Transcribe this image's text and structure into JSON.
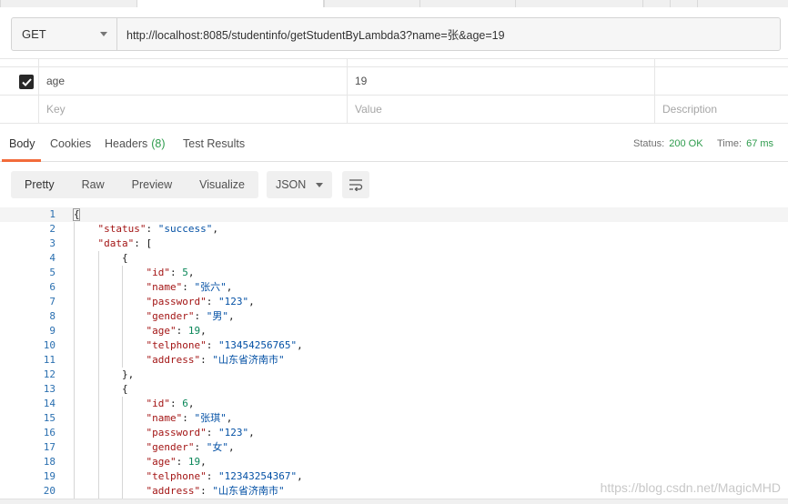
{
  "request": {
    "method": "GET",
    "url": "http://localhost:8085/studentinfo/getStudentByLambda3?name=张&age=19"
  },
  "params": {
    "rows": [
      {
        "key": "age",
        "value": "19",
        "checked": true
      }
    ],
    "placeholder": {
      "key": "Key",
      "value": "Value",
      "description": "Description"
    }
  },
  "response_tabs": {
    "body": "Body",
    "cookies": "Cookies",
    "headers": "Headers",
    "headers_count": "(8)",
    "tests": "Test Results"
  },
  "status": {
    "status_label": "Status:",
    "status_value": "200 OK",
    "time_label": "Time:",
    "time_value": "67 ms"
  },
  "view_modes": {
    "pretty": "Pretty",
    "raw": "Raw",
    "preview": "Preview",
    "visualize": "Visualize",
    "format": "JSON"
  },
  "code_lines": [
    {
      "n": "1",
      "indent": 0,
      "parts": [
        [
          "p",
          "{"
        ]
      ]
    },
    {
      "n": "2",
      "indent": 1,
      "parts": [
        [
          "k",
          "\"status\""
        ],
        [
          "p",
          ": "
        ],
        [
          "s",
          "\"success\""
        ],
        [
          "p",
          ","
        ]
      ]
    },
    {
      "n": "3",
      "indent": 1,
      "parts": [
        [
          "k",
          "\"data\""
        ],
        [
          "p",
          ": ["
        ]
      ]
    },
    {
      "n": "4",
      "indent": 2,
      "parts": [
        [
          "p",
          "{"
        ]
      ]
    },
    {
      "n": "5",
      "indent": 3,
      "parts": [
        [
          "k",
          "\"id\""
        ],
        [
          "p",
          ": "
        ],
        [
          "n",
          "5"
        ],
        [
          "p",
          ","
        ]
      ]
    },
    {
      "n": "6",
      "indent": 3,
      "parts": [
        [
          "k",
          "\"name\""
        ],
        [
          "p",
          ": "
        ],
        [
          "s",
          "\"张六\""
        ],
        [
          "p",
          ","
        ]
      ]
    },
    {
      "n": "7",
      "indent": 3,
      "parts": [
        [
          "k",
          "\"password\""
        ],
        [
          "p",
          ": "
        ],
        [
          "s",
          "\"123\""
        ],
        [
          "p",
          ","
        ]
      ]
    },
    {
      "n": "8",
      "indent": 3,
      "parts": [
        [
          "k",
          "\"gender\""
        ],
        [
          "p",
          ": "
        ],
        [
          "s",
          "\"男\""
        ],
        [
          "p",
          ","
        ]
      ]
    },
    {
      "n": "9",
      "indent": 3,
      "parts": [
        [
          "k",
          "\"age\""
        ],
        [
          "p",
          ": "
        ],
        [
          "n",
          "19"
        ],
        [
          "p",
          ","
        ]
      ]
    },
    {
      "n": "10",
      "indent": 3,
      "parts": [
        [
          "k",
          "\"telphone\""
        ],
        [
          "p",
          ": "
        ],
        [
          "s",
          "\"13454256765\""
        ],
        [
          "p",
          ","
        ]
      ]
    },
    {
      "n": "11",
      "indent": 3,
      "parts": [
        [
          "k",
          "\"address\""
        ],
        [
          "p",
          ": "
        ],
        [
          "s",
          "\"山东省济南市\""
        ]
      ]
    },
    {
      "n": "12",
      "indent": 2,
      "parts": [
        [
          "p",
          "},"
        ]
      ]
    },
    {
      "n": "13",
      "indent": 2,
      "parts": [
        [
          "p",
          "{"
        ]
      ]
    },
    {
      "n": "14",
      "indent": 3,
      "parts": [
        [
          "k",
          "\"id\""
        ],
        [
          "p",
          ": "
        ],
        [
          "n",
          "6"
        ],
        [
          "p",
          ","
        ]
      ]
    },
    {
      "n": "15",
      "indent": 3,
      "parts": [
        [
          "k",
          "\"name\""
        ],
        [
          "p",
          ": "
        ],
        [
          "s",
          "\"张琪\""
        ],
        [
          "p",
          ","
        ]
      ]
    },
    {
      "n": "16",
      "indent": 3,
      "parts": [
        [
          "k",
          "\"password\""
        ],
        [
          "p",
          ": "
        ],
        [
          "s",
          "\"123\""
        ],
        [
          "p",
          ","
        ]
      ]
    },
    {
      "n": "17",
      "indent": 3,
      "parts": [
        [
          "k",
          "\"gender\""
        ],
        [
          "p",
          ": "
        ],
        [
          "s",
          "\"女\""
        ],
        [
          "p",
          ","
        ]
      ]
    },
    {
      "n": "18",
      "indent": 3,
      "parts": [
        [
          "k",
          "\"age\""
        ],
        [
          "p",
          ": "
        ],
        [
          "n",
          "19"
        ],
        [
          "p",
          ","
        ]
      ]
    },
    {
      "n": "19",
      "indent": 3,
      "parts": [
        [
          "k",
          "\"telphone\""
        ],
        [
          "p",
          ": "
        ],
        [
          "s",
          "\"12343254367\""
        ],
        [
          "p",
          ","
        ]
      ]
    },
    {
      "n": "20",
      "indent": 3,
      "parts": [
        [
          "k",
          "\"address\""
        ],
        [
          "p",
          ": "
        ],
        [
          "s",
          "\"山东省济南市\""
        ]
      ]
    }
  ],
  "watermark": "https://blog.csdn.net/MagicMHD",
  "colors": {
    "accent": "#f26b3a",
    "success": "#2d9b4c",
    "line_number": "#2a6fb0"
  }
}
